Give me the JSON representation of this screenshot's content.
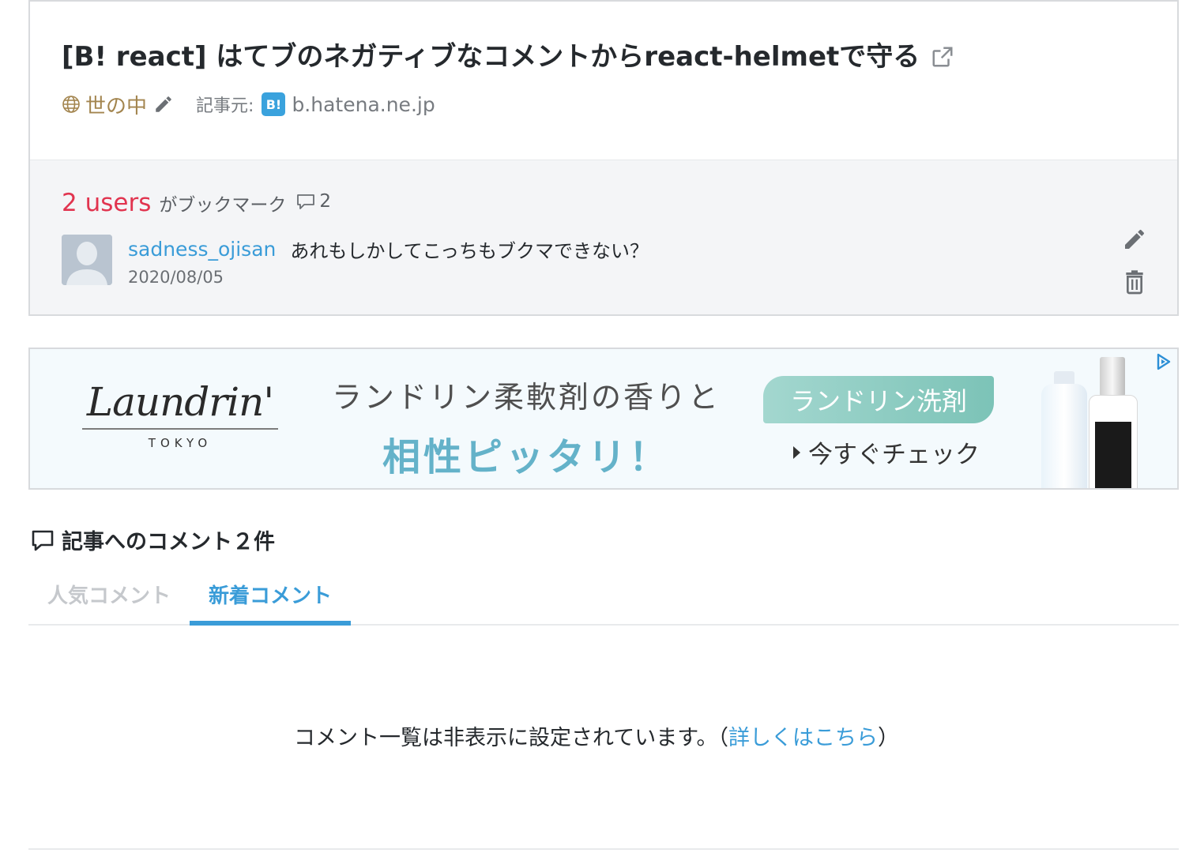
{
  "entry": {
    "title": "[B! react] はてブのネガティブなコメントからreact-helmetで守る",
    "category": "世の中",
    "source_label": "記事元:",
    "source_favicon": "B!",
    "source_domain": "b.hatena.ne.jp"
  },
  "bookmarks": {
    "count_label": "2 users",
    "suffix": "がブックマーク",
    "comment_count": "2",
    "items": [
      {
        "user": "sadness_ojisan",
        "comment": "あれもしかしてこっちもブクマできない？",
        "date": "2020/08/05"
      }
    ]
  },
  "ad": {
    "brand": "Laundrin'",
    "brand_sub": "TOKYO",
    "headline1": "ランドリン柔軟剤の香りと",
    "headline2": "相性ピッタリ！",
    "badge": "ランドリン洗剤",
    "cta": "今すぐチェック"
  },
  "comments": {
    "heading": "記事へのコメント２件",
    "tabs": [
      "人気コメント",
      "新着コメント"
    ],
    "active_tab": "新着コメント",
    "hidden_note": "コメント一覧は非表示に設定されています。（",
    "hidden_link": "詳しくはこちら",
    "hidden_close": "）"
  },
  "colors": {
    "users_red": "#e1344f",
    "link_blue": "#3a9cd8",
    "category_gold": "#a3854f"
  },
  "icons": [
    "external-link-icon",
    "globe-icon",
    "pencil-icon",
    "hatena-favicon",
    "comment-bubble-icon",
    "avatar-placeholder",
    "edit-icon",
    "trash-icon",
    "adchoices-icon"
  ]
}
